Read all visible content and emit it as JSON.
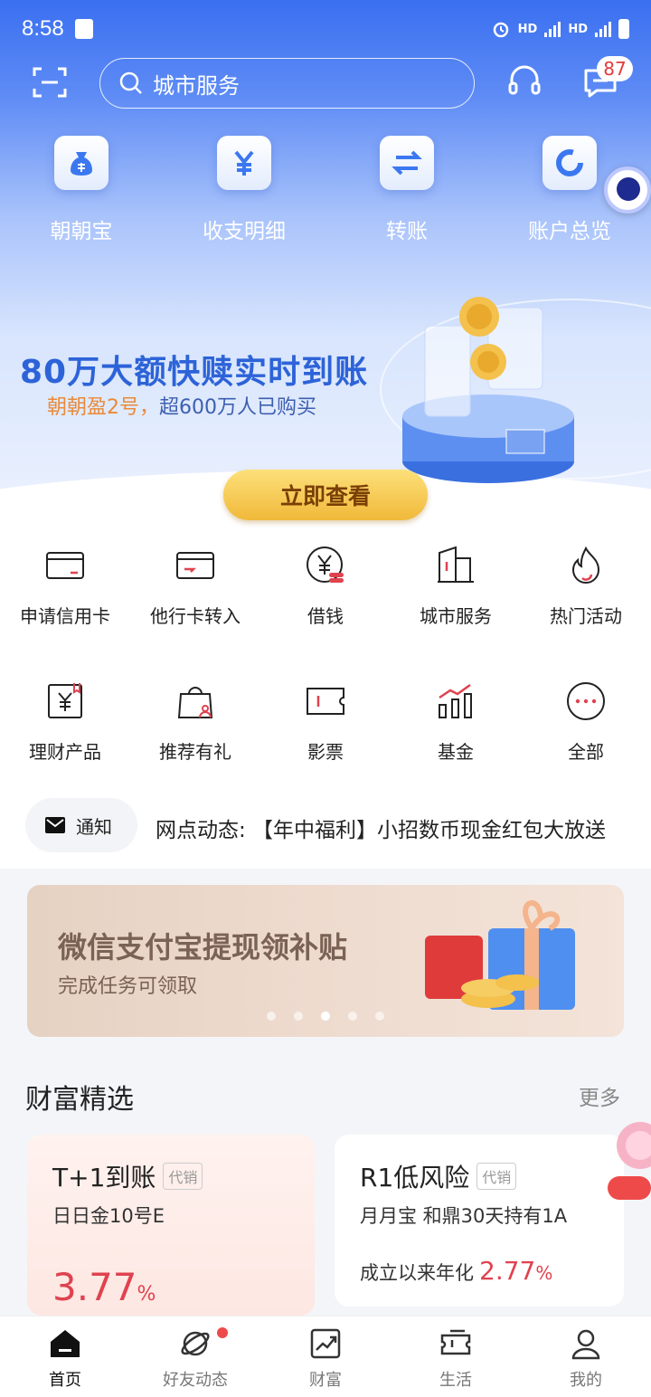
{
  "status": {
    "time": "8:58",
    "net1": "HD",
    "net2": "HD"
  },
  "search": {
    "placeholder": "城市服务"
  },
  "badge": {
    "count": "87"
  },
  "quick": [
    {
      "label": "朝朝宝",
      "icon": "money-bag-icon"
    },
    {
      "label": "收支明细",
      "icon": "yen-icon"
    },
    {
      "label": "转账",
      "icon": "transfer-icon"
    },
    {
      "label": "账户总览",
      "icon": "ring-chart-icon"
    }
  ],
  "banner": {
    "title": "80万大额快赎实时到账",
    "sub_highlight": "朝朝盈2号，",
    "sub_rest": "超600万人已购买",
    "cta": "立即查看"
  },
  "services": [
    {
      "label": "申请信用卡",
      "icon": "credit-card-icon"
    },
    {
      "label": "他行卡转入",
      "icon": "card-transfer-icon"
    },
    {
      "label": "借钱",
      "icon": "yen-coin-icon"
    },
    {
      "label": "城市服务",
      "icon": "building-icon"
    },
    {
      "label": "热门活动",
      "icon": "flame-icon"
    },
    {
      "label": "理财产品",
      "icon": "finance-doc-icon"
    },
    {
      "label": "推荐有礼",
      "icon": "gift-bag-icon"
    },
    {
      "label": "影票",
      "icon": "ticket-icon"
    },
    {
      "label": "基金",
      "icon": "fund-chart-icon"
    },
    {
      "label": "全部",
      "icon": "more-icon"
    }
  ],
  "notice": {
    "label": "通知",
    "text": "网点动态: 【年中福利】小招数币现金红包大放送"
  },
  "promo": {
    "title": "微信支付宝提现领补贴",
    "sub": "完成任务可领取",
    "active_dot": 3
  },
  "section": {
    "title": "财富精选",
    "more": "更多"
  },
  "cards": [
    {
      "title": "T+1到账",
      "tag": "代销",
      "sub": "日日金10号E",
      "rate": "3.77",
      "unit": "%"
    },
    {
      "title": "R1低风险",
      "tag": "代销",
      "sub": "月月宝  和鼎30天持有1A",
      "rate_label": "成立以来年化",
      "rate": "2.77",
      "unit": "%"
    }
  ],
  "tabs": [
    {
      "label": "首页",
      "active": true
    },
    {
      "label": "好友动态"
    },
    {
      "label": "财富"
    },
    {
      "label": "生活"
    },
    {
      "label": "我的"
    }
  ],
  "colors": {
    "brand_blue": "#3a6ff0",
    "accent_red": "#e0424f",
    "cta_gold": "#f0b93a"
  }
}
